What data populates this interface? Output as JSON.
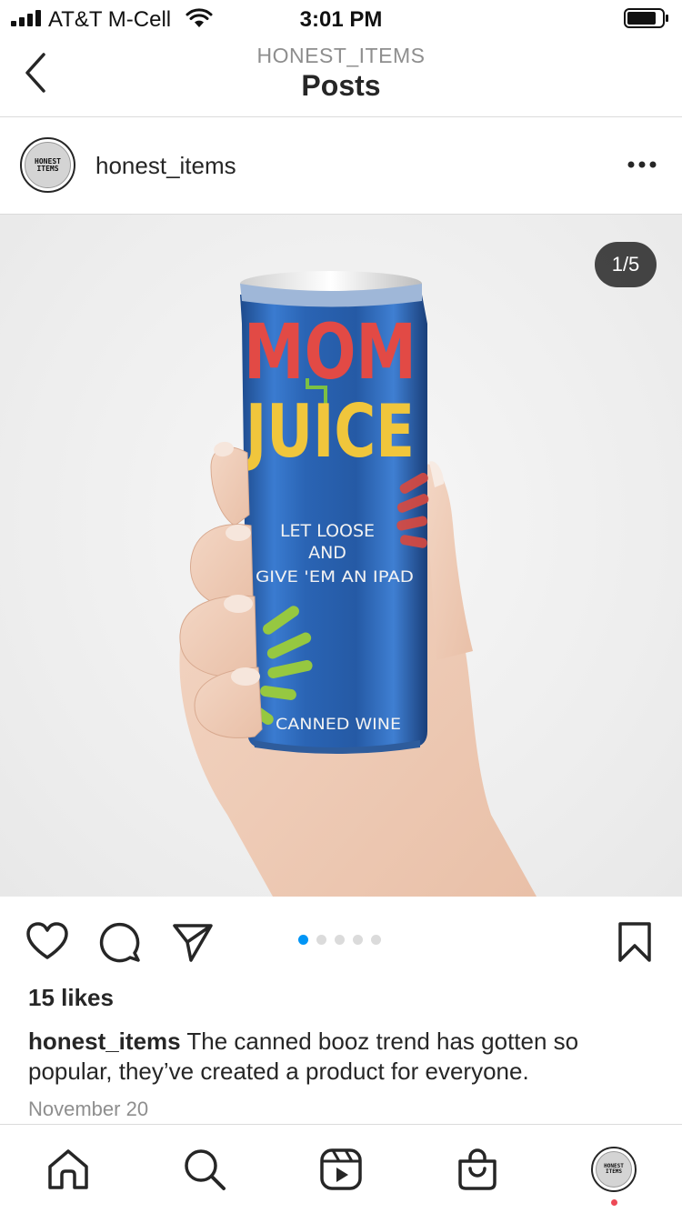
{
  "status_bar": {
    "carrier": "AT&T M-Cell",
    "time": "3:01 PM",
    "signal_bars": 4,
    "battery_level": 0.85
  },
  "header": {
    "subtitle": "HONEST_ITEMS",
    "title": "Posts"
  },
  "post": {
    "username": "honest_items",
    "avatar_text": "HONEST ITEMS",
    "media_counter": "1/5",
    "current_slide": 1,
    "total_slides": 5,
    "product": {
      "line1": "MOM",
      "line2": "JUICE",
      "tagline1": "LET LOOSE",
      "tagline2": "AND",
      "tagline3": "GIVE 'EM AN IPAD",
      "footer": "CANNED WINE"
    },
    "likes": "15 likes",
    "caption_user": "honest_items",
    "caption_text": " The canned booz trend has gotten so popular, they’ve created a product for everyone.",
    "date": "November 20"
  },
  "tab_bar": {
    "items": [
      {
        "icon": "home-icon"
      },
      {
        "icon": "search-icon"
      },
      {
        "icon": "reels-icon"
      },
      {
        "icon": "shop-icon"
      },
      {
        "icon": "profile-avatar"
      }
    ],
    "avatar_text": "HONEST ITEMS"
  },
  "colors": {
    "accent": "#0095f6",
    "notification": "#ed4956",
    "can_blue": "#2a64b4"
  }
}
